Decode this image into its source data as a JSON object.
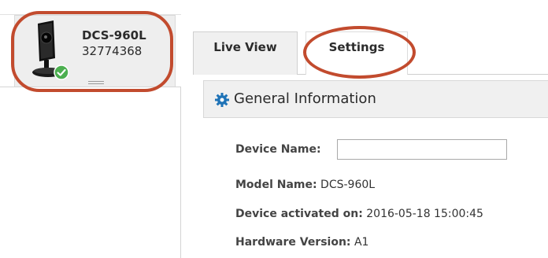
{
  "device": {
    "name": "DCS-960L",
    "id": "32774368",
    "status_icon": "check-circle-icon"
  },
  "tabs": [
    {
      "label": "Live View",
      "active": false
    },
    {
      "label": "Settings",
      "active": true
    }
  ],
  "section": {
    "title": "General Information",
    "icon": "gear-icon"
  },
  "fields": {
    "device_name_label": "Device Name:",
    "device_name_value": "",
    "model_label": "Model Name:",
    "model_value": "DCS-960L",
    "activated_label": "Device activated on:",
    "activated_value": "2016-05-18 15:00:45",
    "hardware_label": "Hardware Version:",
    "hardware_value": "A1"
  },
  "colors": {
    "highlight": "#c24b2e",
    "status_ok": "#4caf50",
    "gear_blue": "#1f73b7"
  }
}
